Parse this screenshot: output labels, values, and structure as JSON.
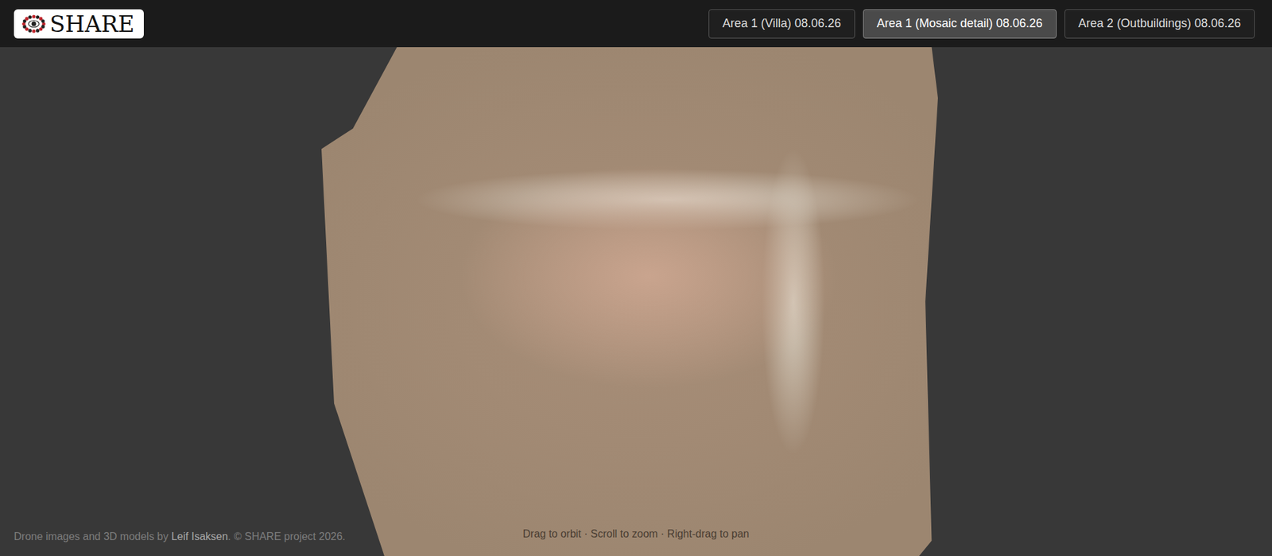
{
  "logo": {
    "text": "SHARE"
  },
  "tabs": [
    {
      "label": "Area 1 (Villa) 08.06.26",
      "selected": false
    },
    {
      "label": "Area 1 (Mosaic detail) 08.06.26",
      "selected": true
    },
    {
      "label": "Area 2 (Outbuildings) 08.06.26",
      "selected": false
    }
  ],
  "viewer": {
    "hint": "Drag to orbit · Scroll to zoom · Right-drag to pan"
  },
  "credits": {
    "prefix": "Drone images and 3D models by",
    "author": "Leif Isaksen",
    "suffix": ". © SHARE project 2026."
  }
}
